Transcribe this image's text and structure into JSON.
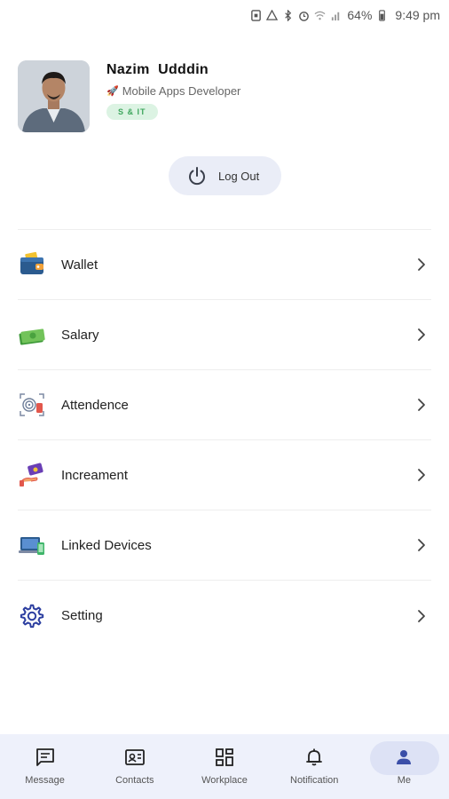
{
  "status_bar": {
    "battery_percent": "64%",
    "time": "9:49 pm",
    "icons": [
      "sim-icon",
      "drive-icon",
      "bluetooth-icon",
      "alarm-icon",
      "wifi-icon",
      "signal-icon",
      "battery-icon"
    ]
  },
  "profile": {
    "name": "Nazim  Udddin",
    "role": "Mobile Apps Developer",
    "department_badge": "S & IT"
  },
  "logout": {
    "label": "Log Out"
  },
  "menu": {
    "items": [
      {
        "label": "Wallet",
        "icon": "wallet-icon"
      },
      {
        "label": "Salary",
        "icon": "cash-icon"
      },
      {
        "label": "Attendence",
        "icon": "fingerprint-icon"
      },
      {
        "label": "Increament",
        "icon": "money-hand-icon"
      },
      {
        "label": "Linked Devices",
        "icon": "devices-icon"
      },
      {
        "label": "Setting",
        "icon": "gear-icon"
      }
    ]
  },
  "bottom_nav": {
    "items": [
      {
        "label": "Message",
        "icon": "message-icon"
      },
      {
        "label": "Contacts",
        "icon": "contacts-icon"
      },
      {
        "label": "Workplace",
        "icon": "workplace-icon"
      },
      {
        "label": "Notification",
        "icon": "bell-icon"
      },
      {
        "label": "Me",
        "icon": "person-icon"
      }
    ],
    "active": "Me"
  },
  "colors": {
    "accent": "#3b4fa8",
    "badge_bg": "#dcf3e3",
    "badge_text": "#3ea65d",
    "nav_bg": "#eef1fb"
  }
}
